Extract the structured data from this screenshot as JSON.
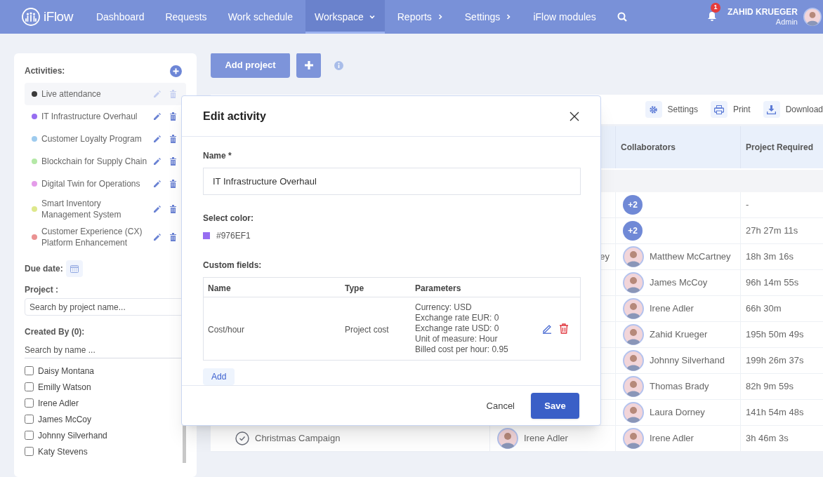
{
  "nav": {
    "logo": "iFlow",
    "items": [
      {
        "label": "Dashboard",
        "selected": false,
        "kind": "link"
      },
      {
        "label": "Requests",
        "selected": false,
        "kind": "link"
      },
      {
        "label": "Work schedule",
        "selected": false,
        "kind": "link"
      },
      {
        "label": "Workspace",
        "selected": true,
        "kind": "dropdown"
      },
      {
        "label": "Reports",
        "selected": false,
        "kind": "submenu"
      },
      {
        "label": "Settings",
        "selected": false,
        "kind": "submenu"
      },
      {
        "label": "iFlow modules",
        "selected": false,
        "kind": "link"
      }
    ],
    "notifications": "1",
    "user": {
      "name": "ZAHID KRUEGER",
      "role": "Admin"
    }
  },
  "toolbar": {
    "add_project": "Add project"
  },
  "sidebar": {
    "activities_title": "Activities:",
    "activities": [
      {
        "name": "Live attendance",
        "color": "#3a3a3a",
        "selected": true
      },
      {
        "name": "IT Infrastructure Overhaul",
        "color": "#976ef1",
        "selected": false
      },
      {
        "name": "Customer Loyalty Program",
        "color": "#9ecbee",
        "selected": false
      },
      {
        "name": "Blockchain for Supply Chain",
        "color": "#b4e8a6",
        "selected": false
      },
      {
        "name": "Digital Twin for Operations",
        "color": "#e49ce9",
        "selected": false
      },
      {
        "name": "Smart Inventory Management System",
        "color": "#dee88c",
        "selected": false
      },
      {
        "name": "Customer Experience (CX) Platform Enhancement",
        "color": "#ea9292",
        "selected": false
      }
    ],
    "due_date_label": "Due date:",
    "project_label": "Project :",
    "project_placeholder": "Search by project name...",
    "created_by_label": "Created By (0):",
    "name_placeholder": "Search by name ...",
    "people": [
      {
        "name": "Daisy Montana",
        "checked": false
      },
      {
        "name": "Emilly Watson",
        "checked": false
      },
      {
        "name": "Irene Adler",
        "checked": false
      },
      {
        "name": "James McCoy",
        "checked": false
      },
      {
        "name": "Johnny Silverhand",
        "checked": false
      },
      {
        "name": "Katy Stevens",
        "checked": false
      }
    ]
  },
  "table": {
    "actions": [
      {
        "kind": "settings",
        "label": "Settings"
      },
      {
        "kind": "print",
        "label": "Print"
      },
      {
        "kind": "download",
        "label": "Download"
      }
    ],
    "columns": [
      "Collaborators",
      "Project Required"
    ],
    "rows": [
      {
        "collaborators": {
          "kind": "count",
          "text": "+2"
        },
        "required": "-"
      },
      {
        "collaborators": {
          "kind": "count",
          "text": "+2"
        },
        "required": "27h 27m 11s"
      },
      {
        "created_by": "ey",
        "collaborators": {
          "kind": "person",
          "text": "Matthew McCartney"
        },
        "required": "18h 3m 16s"
      },
      {
        "collaborators": {
          "kind": "person",
          "text": "James McCoy"
        },
        "required": "96h 14m 55s"
      },
      {
        "collaborators": {
          "kind": "person",
          "text": "Irene Adler"
        },
        "required": "66h 30m"
      },
      {
        "collaborators": {
          "kind": "person",
          "text": "Zahid Krueger"
        },
        "required": "195h 50m 49s"
      },
      {
        "collaborators": {
          "kind": "person",
          "text": "Johnny Silverhand"
        },
        "required": "199h 26m 37s"
      },
      {
        "collaborators": {
          "kind": "person",
          "text": "Thomas Brady"
        },
        "required": "82h 9m 59s"
      },
      {
        "collaborators": {
          "kind": "person",
          "text": "Laura Dorney"
        },
        "required": "141h 54m 48s"
      },
      {
        "project": "Christmas Campaign",
        "created_by_person": "Irene Adler",
        "collaborators": {
          "kind": "person",
          "text": "Irene Adler"
        },
        "required": "3h 46m 3s"
      }
    ]
  },
  "modal": {
    "title": "Edit activity",
    "name_label": "Name *",
    "name_value": "IT Infrastructure Overhaul",
    "color_label": "Select color:",
    "color": "#976ef1",
    "color_text": "#976EF1",
    "custom_fields_label": "Custom fields:",
    "custom_columns": [
      "Name",
      "Type",
      "Parameters"
    ],
    "custom_rows": [
      {
        "name": "Cost/hour",
        "type": "Project cost",
        "parameters": [
          "Currency: USD",
          "Exchange rate EUR: 0",
          "Exchange rate USD: 0",
          "Unit of measure: Hour",
          "Billed cost per hour: 0.95"
        ]
      }
    ],
    "add": "Add",
    "cancel": "Cancel",
    "save": "Save"
  }
}
